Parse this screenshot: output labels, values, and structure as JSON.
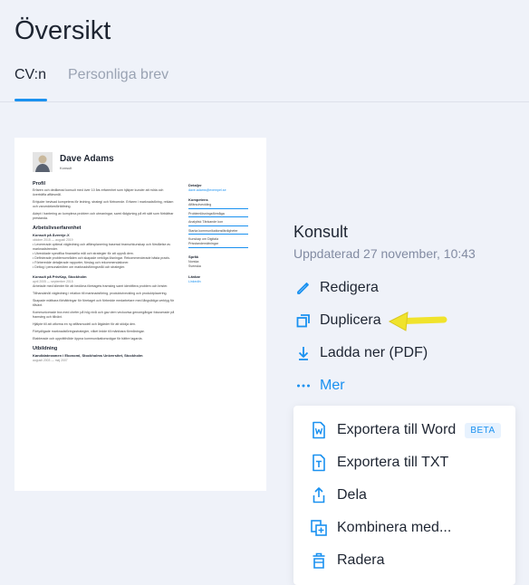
{
  "page": {
    "title": "Översikt"
  },
  "tabs": [
    {
      "label": "CV:n",
      "active": true
    },
    {
      "label": "Personliga brev",
      "active": false
    }
  ],
  "resume_preview": {
    "name": "Dave Adams",
    "role": "Konsult",
    "profile": {
      "heading": "Profil",
      "paragraphs": [
        "Erfaren och dedikerad konsult med över 10 års erfarenhet som hjälper kunder att möta och överträffa affärsmål.",
        "Erbjuder bevisad kompetens för ledning, strategi och förtroende. Erfaren i marknadsföring, reklam och varumärkesförtättning.",
        "Adept i hantering av komplexa problem och utmaningar, samt rådgivning på ett sätt som förbättrar prestanda."
      ]
    },
    "experience": {
      "heading": "Arbetslivserfarenhet",
      "jobs": [
        {
          "title": "Konsult på Äventyr-X",
          "date": "oktober 2015 — augusti 2019",
          "bullets": [
            "Levererade optimal vägledning och affärsplanering baserad branschkunskap och förståelse av marknadstrender.",
            "Utvecklade specifika finansiella mål och strategier för att uppnå dem.",
            "Definierade problemområden och skapade verkliga lösningar. Rekommenderade bästa praxis.",
            "Förberedde detaljerade rapporter, förslag och rekommendationer.",
            "Deltog i personalmöten om marknadsföringsmål och strategier."
          ]
        },
        {
          "title": "Konsult på PrivKap, Stockholm",
          "date": "april 2005 — september 2015",
          "paragraphs": [
            "Arbetade med klienter för att bedöma företagets framsteg samt identifiera problem och brister.",
            "Tillhandahöll vägledning i relation till marknadsföring, produktutveckling och produktplacering.",
            "Skapade mätbara förbättringar för företaget och förbedde medarbetare med långsiktiga verktyg för tillväxt.",
            "Kommunicerade bra med chefer på hög nivå och gav dem veckovisa genomgångar fokuserade på framsteg och tillväxt.",
            "Hjälpte till att utforma en ny affärsmodell och åtgärder för att stödja den.",
            "Förtydligade marknadsföringsstrategier, vilket ledde till märkbara förmåningar.",
            "Etablerade och upprätthölde öppna kommunikationsvägar för bättre lagarda."
          ]
        }
      ]
    },
    "education": {
      "heading": "Utbildning",
      "entries": [
        {
          "title": "Kandidatexamen i Ekonomi, Stockholms Universitet, Stockholm",
          "date": "augusti 2003 — maj 2007"
        }
      ]
    },
    "sidebar": {
      "details_heading": "Detaljer",
      "email": "dave.adams@exempel.se",
      "skills_heading": "Kompetens",
      "skills": [
        "Affärsutveckling",
        "Problemlösningsförmåga",
        "Analytisk Tänkande kon",
        "Starka kommunikationsfärdigheter",
        "Kunskap om Digitala Prisstandemätningar"
      ],
      "languages_heading": "Språk",
      "languages": [
        "Norska",
        "Svenska"
      ],
      "links_heading": "Länkar",
      "links": [
        "LinkedIn"
      ]
    }
  },
  "document": {
    "name": "Konsult",
    "updated": "Uppdaterad 27 november, 10:43"
  },
  "actions": [
    {
      "label": "Redigera",
      "icon": "pencil-icon"
    },
    {
      "label": "Duplicera",
      "icon": "duplicate-icon",
      "highlighted_by": "yellow-arrow"
    },
    {
      "label": "Ladda ner (PDF)",
      "icon": "download-icon"
    },
    {
      "label": "Mer",
      "icon": "more-dots-icon"
    }
  ],
  "more_menu": [
    {
      "label": "Exportera till Word",
      "icon": "word-file-icon",
      "badge": "BETA"
    },
    {
      "label": "Exportera till TXT",
      "icon": "text-file-icon"
    },
    {
      "label": "Dela",
      "icon": "share-icon"
    },
    {
      "label": "Kombinera med...",
      "icon": "combine-icon"
    },
    {
      "label": "Radera",
      "icon": "trash-icon"
    }
  ],
  "colors": {
    "accent": "#1a91f0",
    "background": "#eff2f9",
    "text": "#1e2532",
    "muted": "#828ba2",
    "arrow": "#f0e32c"
  }
}
